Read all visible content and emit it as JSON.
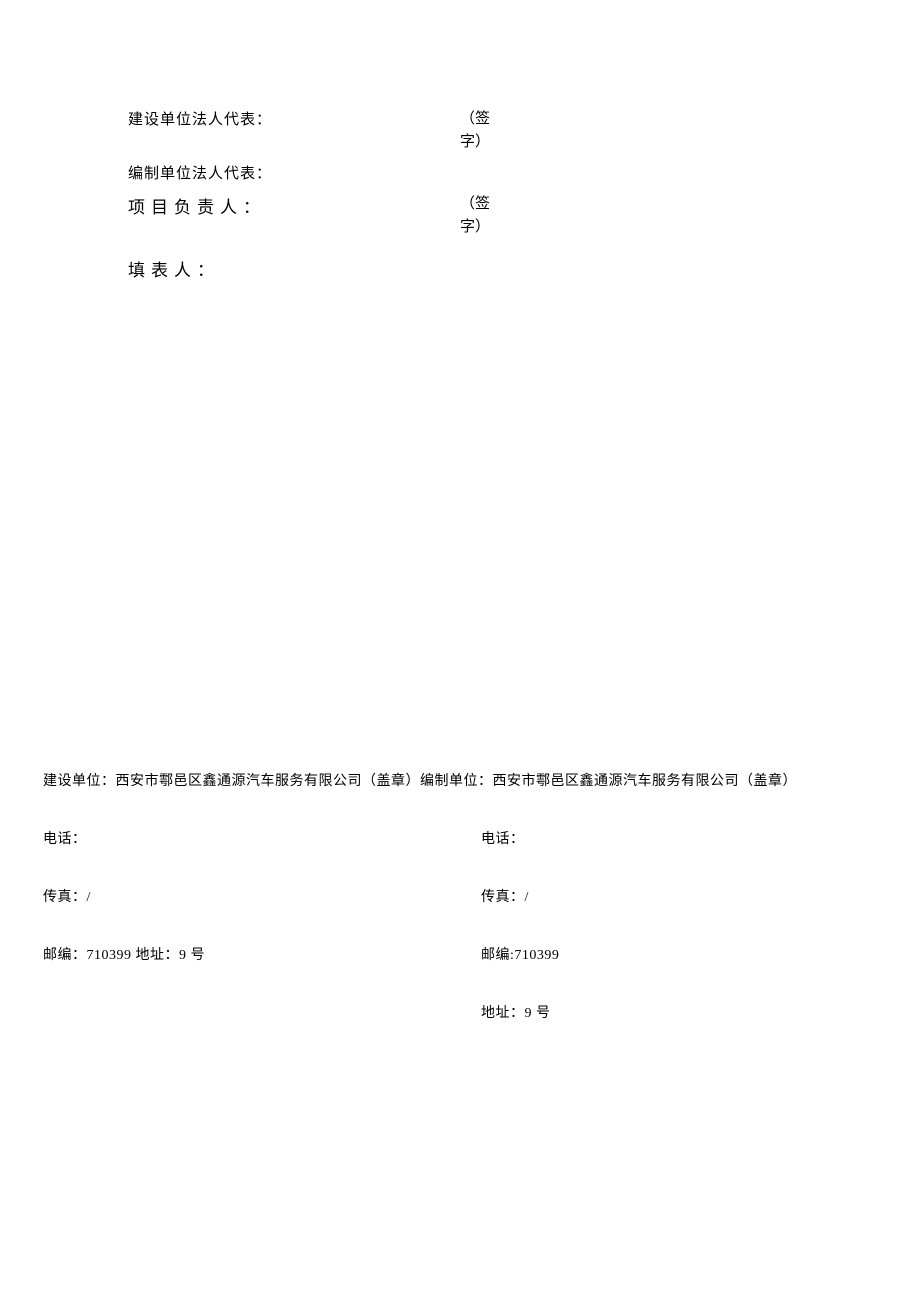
{
  "top": {
    "line1_label": "建设单位法人代表：",
    "line2_label": "编制单位法人代表：",
    "line3_label": "项目负责人：",
    "line4_label": "填表人：",
    "sign_text": "（签字）"
  },
  "bottom": {
    "unit_line": "建设单位：西安市鄠邑区鑫通源汽车服务有限公司（盖章）编制单位：西安市鄠邑区鑫通源汽车服务有限公司（盖章）",
    "left": {
      "phone": "电话：",
      "fax": "传真：/",
      "postal_address": "邮编：710399 地址：9 号"
    },
    "right": {
      "phone": "电话：",
      "fax": "传真：/",
      "postal": "邮编:710399",
      "address": "地址：9 号"
    }
  }
}
